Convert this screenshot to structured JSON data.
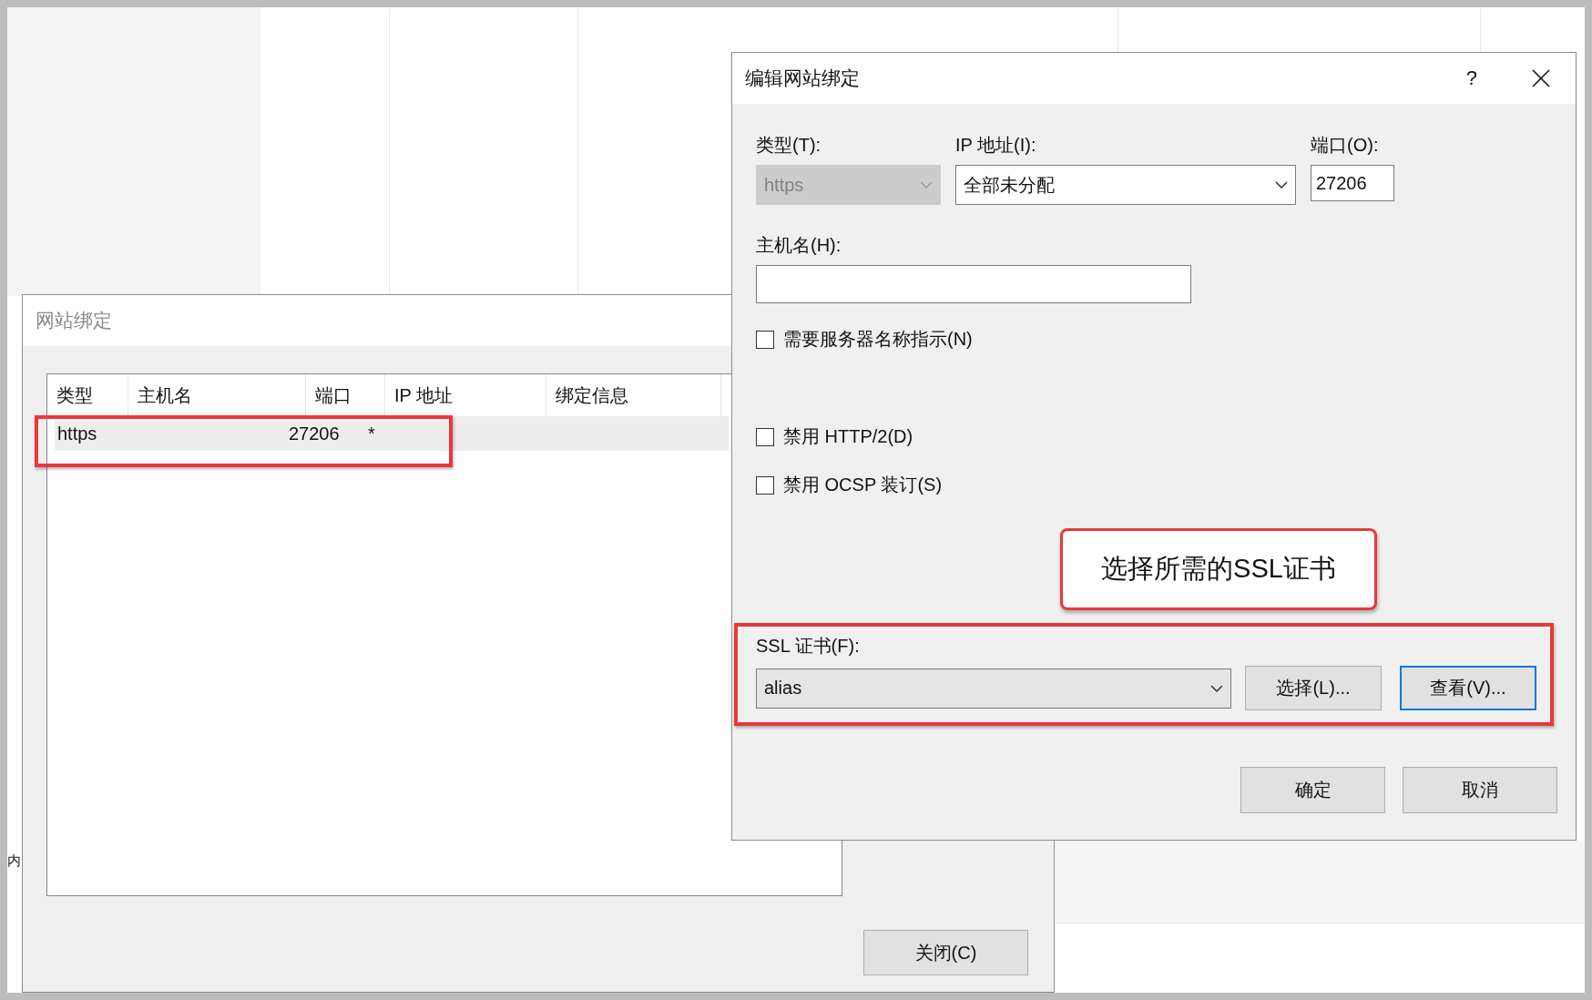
{
  "background_app": {
    "side_label": "内"
  },
  "bindings_window": {
    "title": "网站绑定",
    "columns": [
      "类型",
      "主机名",
      "端口",
      "IP 地址",
      "绑定信息"
    ],
    "rows": [
      {
        "type": "https",
        "port": "27206",
        "ip": "*",
        "selected": true
      }
    ],
    "close_button": "关闭(C)"
  },
  "edit_dialog": {
    "title": "编辑网站绑定",
    "help": "?",
    "type": {
      "label": "类型(T):",
      "value": "https",
      "disabled": true
    },
    "ip": {
      "label": "IP 地址(I):",
      "value": "全部未分配"
    },
    "port": {
      "label": "端口(O):",
      "value": "27206"
    },
    "hostname": {
      "label": "主机名(H):"
    },
    "checkboxes": [
      {
        "label": "需要服务器名称指示(N)",
        "checked": false
      },
      {
        "label": "禁用 HTTP/2(D)",
        "checked": false
      },
      {
        "label": "禁用 OCSP 装订(S)",
        "checked": false
      }
    ],
    "ssl": {
      "label": "SSL 证书(F):",
      "value": "alias"
    },
    "select_button": "选择(L)...",
    "view_button": {
      "label": "查看(V)...",
      "focused": true
    },
    "ok_button": "确定",
    "cancel_button": "取消"
  },
  "annotations": {
    "callout": "选择所需的SSL证书"
  }
}
